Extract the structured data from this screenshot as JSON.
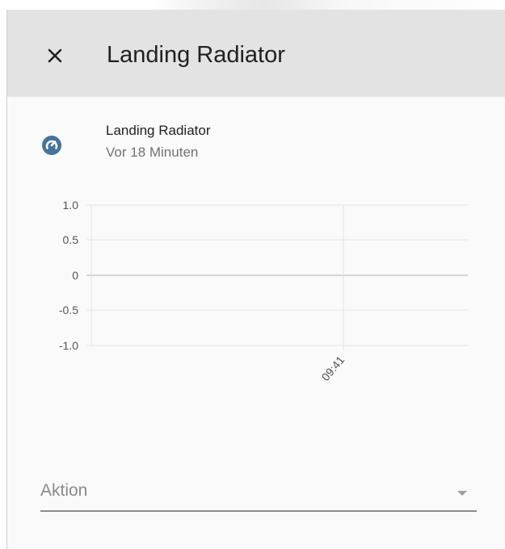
{
  "dialog": {
    "title": "Landing Radiator",
    "close_icon": "close-icon"
  },
  "entity": {
    "icon": "radiator-state-icon",
    "icon_color": "#44739e",
    "name": "Landing Radiator",
    "last_changed": "Vor 18 Minuten"
  },
  "chart_data": {
    "type": "line",
    "title": "",
    "xlabel": "",
    "ylabel": "",
    "ylim": [
      -1.0,
      1.0
    ],
    "y_ticks": [
      "1.0",
      "0.5",
      "0",
      "-0.5",
      "-1.0"
    ],
    "x_ticks": [
      "09:41"
    ],
    "grid": true,
    "series": []
  },
  "action": {
    "label": "Aktion",
    "arrow_icon": "dropdown-arrow-icon"
  }
}
